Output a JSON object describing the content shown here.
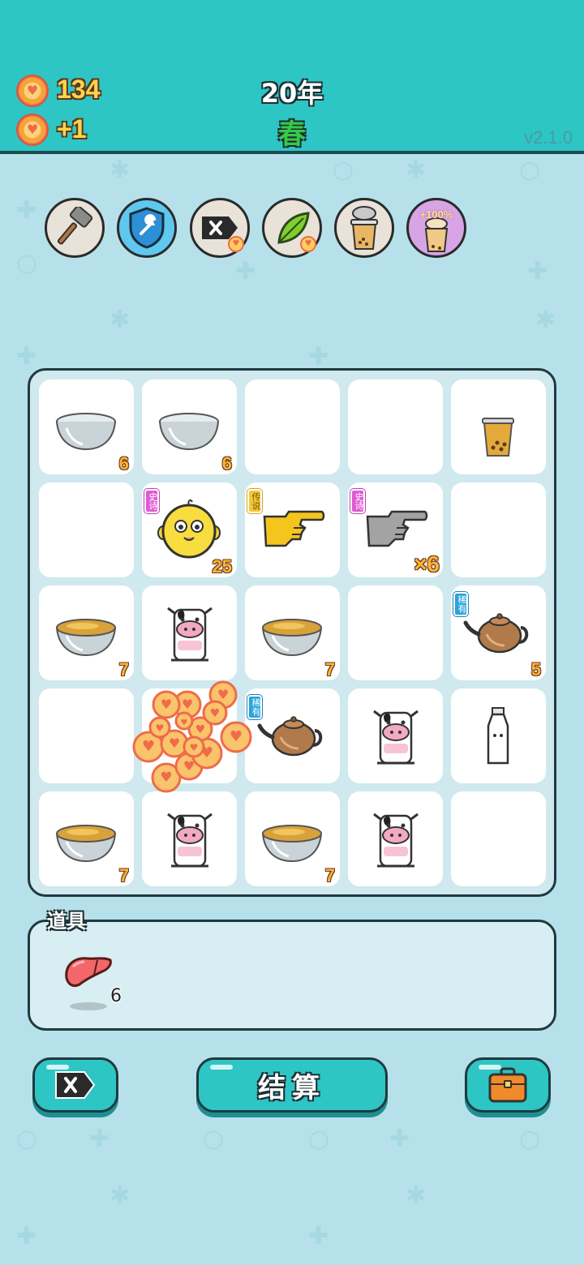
{
  "header": {
    "money": "134",
    "income": "+1",
    "year": "20年",
    "season": "春",
    "version": "v2.1.0"
  },
  "skills": [
    {
      "name": "hammer"
    },
    {
      "name": "shield"
    },
    {
      "name": "remove"
    },
    {
      "name": "leaf"
    },
    {
      "name": "milk-tea"
    },
    {
      "name": "milk-tea-boost",
      "label": "+100%"
    }
  ],
  "board": {
    "cells": [
      {
        "item": "bowl",
        "count": "6"
      },
      {
        "item": "bowl",
        "count": "6"
      },
      {
        "item": "empty"
      },
      {
        "item": "empty"
      },
      {
        "item": "bubble-tea-cup"
      },
      {
        "item": "empty"
      },
      {
        "item": "chick",
        "tag": "史诗",
        "count": "25"
      },
      {
        "item": "yellow-hand",
        "tag": "传说"
      },
      {
        "item": "gray-hand",
        "tag": "史诗",
        "count": "×6"
      },
      {
        "item": "empty"
      },
      {
        "item": "tea-bowl",
        "count": "7"
      },
      {
        "item": "cow"
      },
      {
        "item": "tea-bowl",
        "count": "7"
      },
      {
        "item": "empty"
      },
      {
        "item": "teapot",
        "tag": "稀有",
        "count": "5"
      },
      {
        "item": "empty"
      },
      {
        "item": "coin-burst"
      },
      {
        "item": "teapot",
        "tag": "稀有"
      },
      {
        "item": "cow"
      },
      {
        "item": "milk-bottle"
      },
      {
        "item": "tea-bowl",
        "count": "7"
      },
      {
        "item": "cow"
      },
      {
        "item": "tea-bowl",
        "count": "7"
      },
      {
        "item": "cow"
      },
      {
        "item": "empty"
      }
    ]
  },
  "items_panel": {
    "title": "道具",
    "items": [
      {
        "name": "liver",
        "count": "6"
      }
    ]
  },
  "buttons": {
    "remove_label": "",
    "settle_label": "结算",
    "bag_label": ""
  }
}
